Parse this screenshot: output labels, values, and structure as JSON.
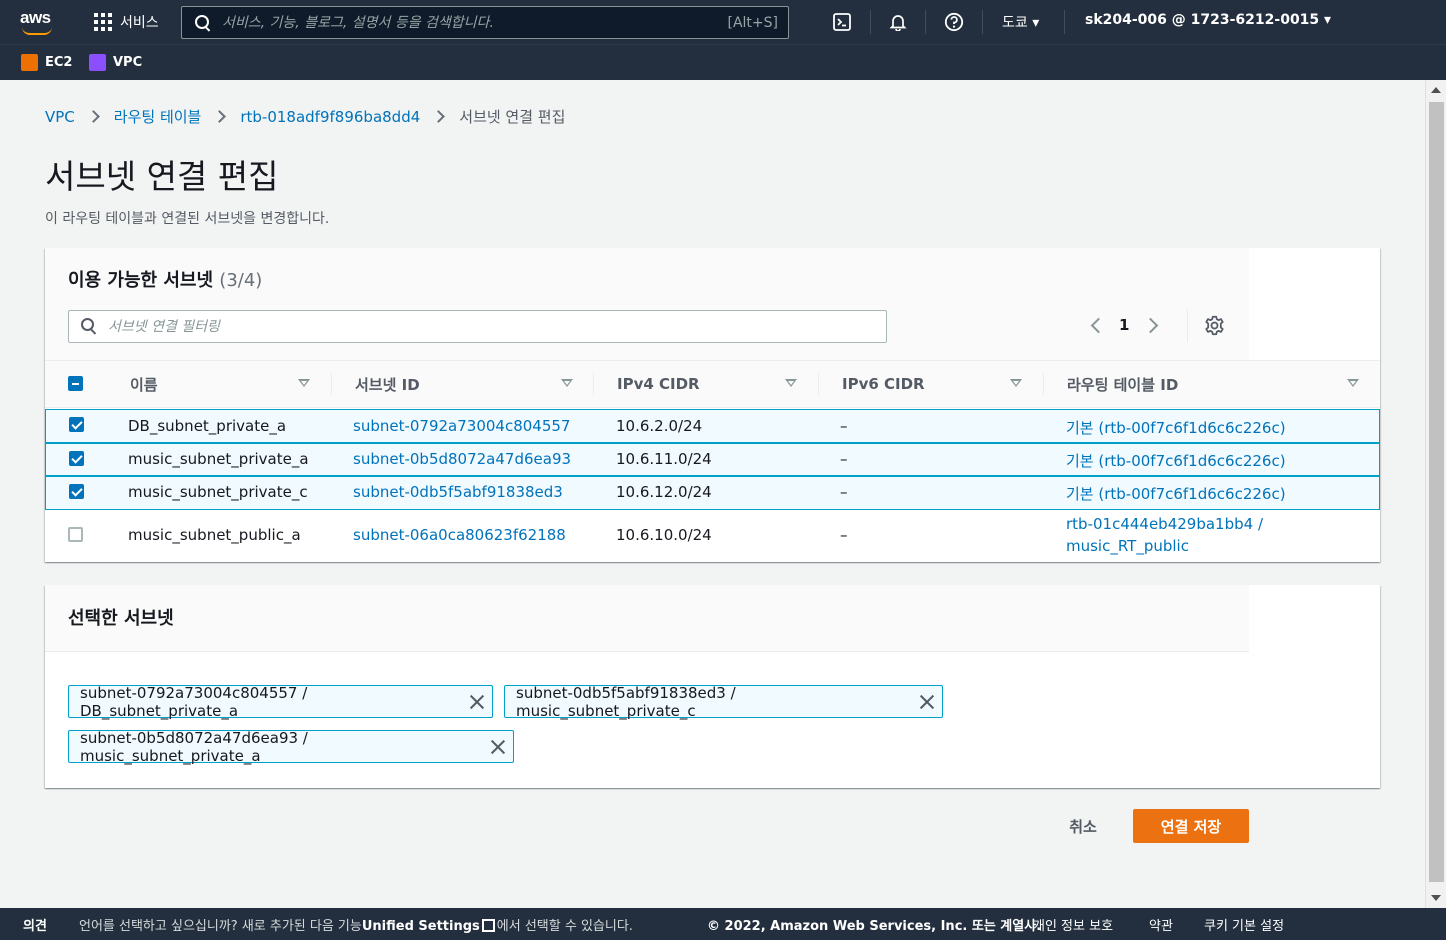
{
  "topnav": {
    "logo": "aws",
    "services_label": "서비스",
    "search_placeholder": "서비스, 기능, 블로그, 설명서 등을 검색합니다.",
    "search_shortcut": "[Alt+S]",
    "region": "도쿄 ▾",
    "account": "sk204-006 @ 1723-6212-0015 ▾",
    "icons": [
      "cloudshell-icon",
      "bell-icon",
      "help-icon"
    ]
  },
  "favorites": [
    {
      "label": "EC2",
      "color": "#ed7100"
    },
    {
      "label": "VPC",
      "color": "#8c4fff"
    }
  ],
  "breadcrumb": {
    "items": [
      "VPC",
      "라우팅 테이블",
      "rtb-018adf9f896ba8dd4"
    ],
    "current": "서브넷 연결 편집"
  },
  "page": {
    "title": "서브넷 연결 편집",
    "description": "이 라우팅 테이블과 연결된 서브넷을 변경합니다."
  },
  "available": {
    "title": "이용 가능한 서브넷",
    "count": "(3/4)",
    "filter_placeholder": "서브넷 연결 필터링",
    "page": "1",
    "columns": [
      "이름",
      "서브넷 ID",
      "IPv4 CIDR",
      "IPv6 CIDR",
      "라우팅 테이블 ID"
    ],
    "rows": [
      {
        "checked": true,
        "name": "DB_subnet_private_a",
        "subnet_id": "subnet-0792a73004c804557",
        "ipv4": "10.6.2.0/24",
        "ipv6": "–",
        "rtb": "기본 (rtb-00f7c6f1d6c6c226c)",
        "rtb2": ""
      },
      {
        "checked": true,
        "name": "music_subnet_private_a",
        "subnet_id": "subnet-0b5d8072a47d6ea93",
        "ipv4": "10.6.11.0/24",
        "ipv6": "–",
        "rtb": "기본 (rtb-00f7c6f1d6c6c226c)",
        "rtb2": ""
      },
      {
        "checked": true,
        "name": "music_subnet_private_c",
        "subnet_id": "subnet-0db5f5abf91838ed3",
        "ipv4": "10.6.12.0/24",
        "ipv6": "–",
        "rtb": "기본 (rtb-00f7c6f1d6c6c226c)",
        "rtb2": ""
      },
      {
        "checked": false,
        "name": "music_subnet_public_a",
        "subnet_id": "subnet-06a0ca80623f62188",
        "ipv4": "10.6.10.0/24",
        "ipv6": "–",
        "rtb": "rtb-01c444eb429ba1bb4 /",
        "rtb2": "music_RT_public"
      }
    ]
  },
  "selected": {
    "title": "선택한 서브넷",
    "tokens": [
      "subnet-0792a73004c804557 / DB_subnet_private_a",
      "subnet-0db5f5abf91838ed3 / music_subnet_private_c",
      "subnet-0b5d8072a47d6ea93 / music_subnet_private_a"
    ]
  },
  "actions": {
    "cancel": "취소",
    "save": "연결 저장"
  },
  "footer": {
    "feedback": "의견",
    "language_pre": "언어를 선택하고 싶으십니까? 새로 추가된 다음 기능",
    "unified_settings": "Unified Settings",
    "language_post": "에서 선택할 수 있습니다.",
    "copyright": "© 2022, Amazon Web Services, Inc. 또는 계열사.",
    "privacy": "개인 정보 보호",
    "terms": "약관",
    "cookies": "쿠키 기본 설정"
  }
}
